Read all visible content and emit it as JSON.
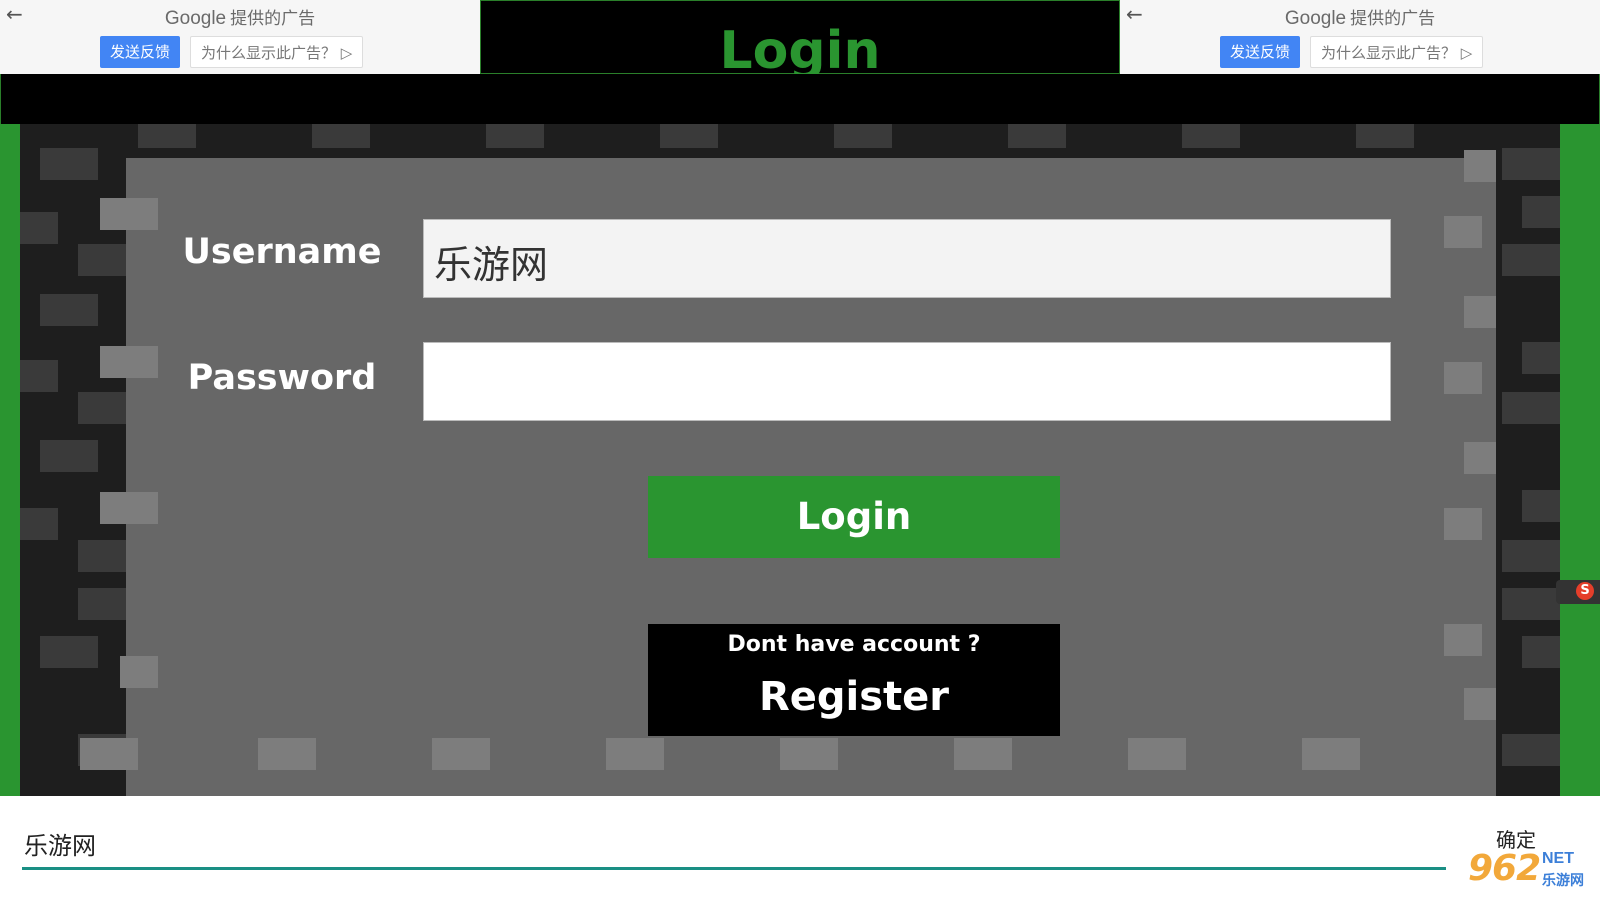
{
  "ads": {
    "back_glyph": "←",
    "google": "Google",
    "provided": "提供的广告",
    "feedback": "发送反馈",
    "why": "为什么显示此广告？",
    "why_icon": "▷"
  },
  "header": {
    "title": "Login"
  },
  "form": {
    "username_label": "Username",
    "username_value": "乐游网",
    "password_label": "Password",
    "password_value": "",
    "login_button": "Login",
    "register_prompt": "Dont have account ?",
    "register_button": "Register"
  },
  "keyboard_input": {
    "value": "乐游网",
    "confirm": "确定"
  },
  "overlay": {
    "sogou_glyph": "S"
  },
  "watermark": {
    "number": "962",
    "net": "NET",
    "cn": "乐游网"
  },
  "colors": {
    "grass": "#2a9530",
    "panel": "#676767",
    "stone": "#1e1e1e",
    "accent_line": "#1a8f84",
    "ad_button": "#4285f4"
  }
}
